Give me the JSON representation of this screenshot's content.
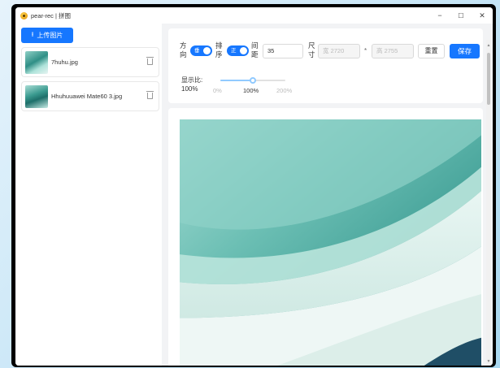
{
  "window": {
    "title": "pear-rec | 拼图",
    "controls": {
      "minimize": "−",
      "maximize": "☐",
      "close": "✕"
    }
  },
  "sidebar": {
    "upload_label": "上传图片",
    "upload_icon": "upload-icon",
    "files": [
      {
        "name": "7huhu.jpg",
        "icon": "delete-icon"
      },
      {
        "name": "Hhuhuuawei Mate60 3.jpg",
        "icon": "delete-icon"
      }
    ]
  },
  "toolbar": {
    "direction": {
      "label_top": "方",
      "label_bottom": "向",
      "value": "垂"
    },
    "order": {
      "label_top": "排",
      "label_bottom": "序",
      "value": "正"
    },
    "spacing": {
      "label_top": "间",
      "label_bottom": "距",
      "value": "35"
    },
    "size": {
      "label_top": "尺",
      "label_bottom": "寸",
      "width_placeholder": "宽 2720",
      "separator": "*",
      "height_placeholder": "高 2755"
    },
    "reset_label": "重置",
    "save_label": "保存",
    "zoom": {
      "label": "显示比:",
      "value_text": "100%",
      "value": 100,
      "min": 0,
      "max": 200,
      "marks": [
        "0%",
        "100%",
        "200%"
      ]
    }
  },
  "colors": {
    "primary": "#1677ff",
    "slider": "#91caff"
  }
}
